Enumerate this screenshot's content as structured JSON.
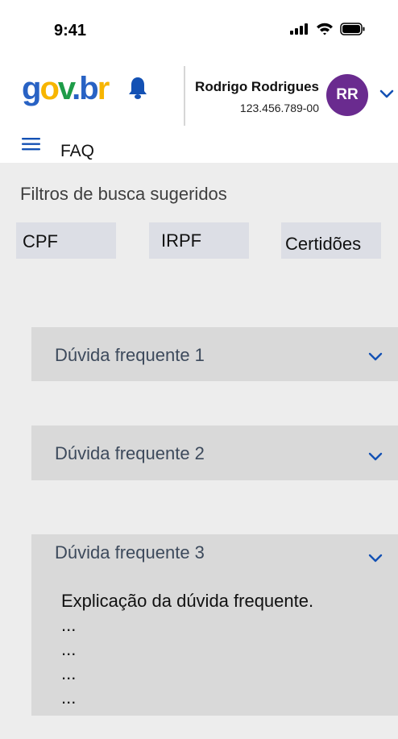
{
  "status_bar": {
    "time": "9:41",
    "icons": [
      "signal-icon",
      "wifi-icon",
      "battery-icon"
    ]
  },
  "header": {
    "logo": {
      "g": "g",
      "o": "o",
      "v": "v",
      "dot": ".",
      "b": "b",
      "r": "r"
    },
    "notification_icon": "bell-icon",
    "user": {
      "name": "Rodrigo Rodrigues",
      "cpf": "123.456.789-00",
      "initials": "RR"
    },
    "menu_icon": "hamburger-menu-icon",
    "page_title": "FAQ"
  },
  "filters": {
    "title": "Filtros de busca sugeridos",
    "chips": [
      "CPF",
      "IRPF",
      "Certidões"
    ]
  },
  "faq": [
    {
      "question": "Dúvida frequente 1",
      "expanded": false
    },
    {
      "question": "Dúvida frequente 2",
      "expanded": false
    },
    {
      "question": "Dúvida frequente 3",
      "expanded": true,
      "answer": [
        "Explicação da dúvida frequente.",
        "...",
        "...",
        "...",
        "..."
      ]
    }
  ],
  "colors": {
    "brand_blue": "#2862c4",
    "brand_yellow": "#f7b500",
    "brand_green": "#1e9c48",
    "avatar_bg": "#6a2b8f",
    "accent_blue": "#1351b4",
    "content_bg": "#ededed",
    "card_bg": "#d9d9d9",
    "chip_bg": "#dcdee5"
  }
}
